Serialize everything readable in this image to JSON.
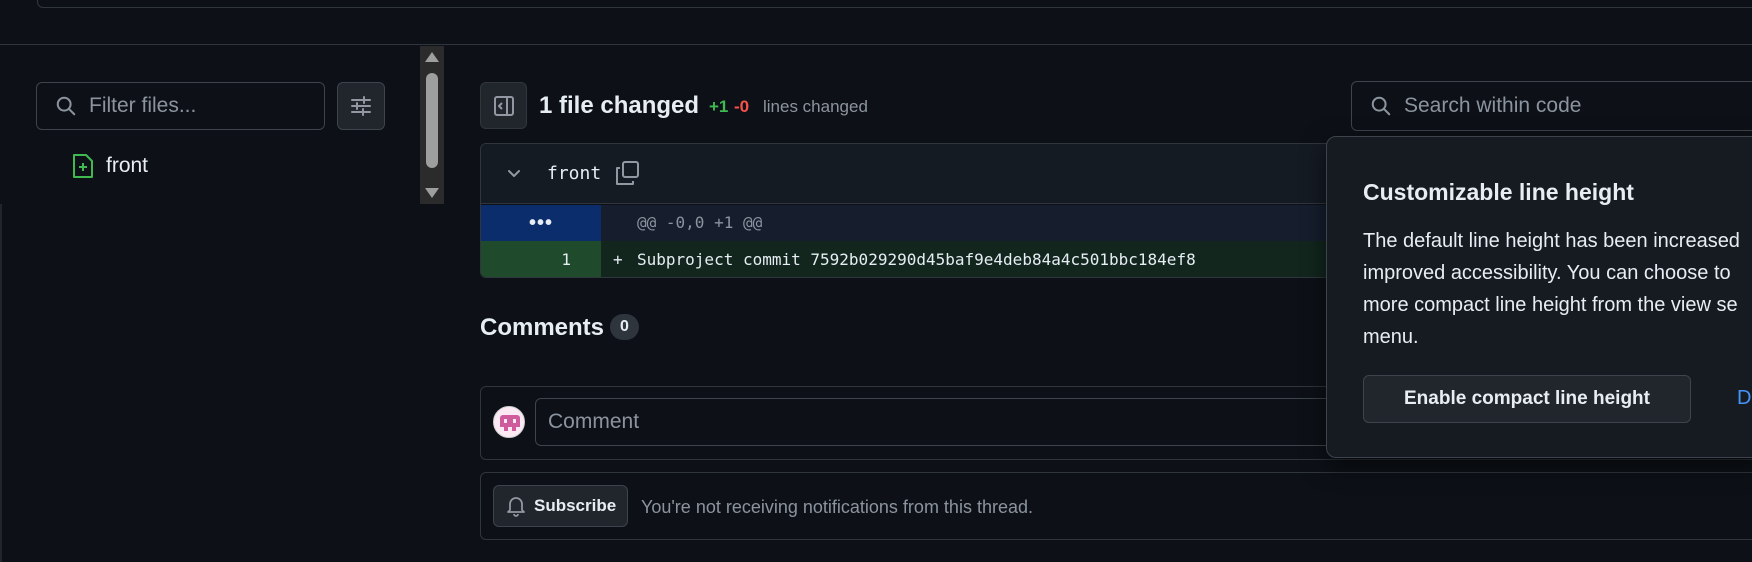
{
  "sidebar": {
    "filter_placeholder": "Filter files...",
    "files": [
      {
        "name": "front",
        "status": "added"
      }
    ]
  },
  "header": {
    "files_changed": "1 file changed",
    "additions": "+1",
    "deletions": "-0",
    "lines_changed": "lines changed",
    "search_placeholder": "Search within code"
  },
  "diff": {
    "filename": "front",
    "hunk_gutter": "•••",
    "hunk_header": "@@ -0,0 +1 @@",
    "lines": [
      {
        "number": "1",
        "sign": "+",
        "text": "Subproject commit 7592b029290d45baf9e4deb84a4c501bbc184ef8"
      }
    ]
  },
  "comments": {
    "title": "Comments",
    "count": "0",
    "input_placeholder": "Comment",
    "subscribe_label": "Subscribe",
    "notification_text": "You're not receiving notifications from this thread."
  },
  "popover": {
    "title": "Customizable line height",
    "body": "The default line height has been increased\nimproved accessibility. You can choose to\nmore compact line height from the view se\nmenu.",
    "button_label": "Enable compact line height",
    "link_label": "D"
  },
  "colors": {
    "background": "#0d1117",
    "additions": "#3fb950",
    "deletions": "#f85149",
    "link": "#4493f8",
    "hunk_gutter": "#0c2d6b",
    "added_line": "#12261e"
  },
  "icons": [
    "search-icon",
    "sliders-icon",
    "file-added-icon",
    "sidebar-collapse-icon",
    "chevron-down-icon",
    "copy-icon",
    "bell-icon",
    "avatar"
  ]
}
